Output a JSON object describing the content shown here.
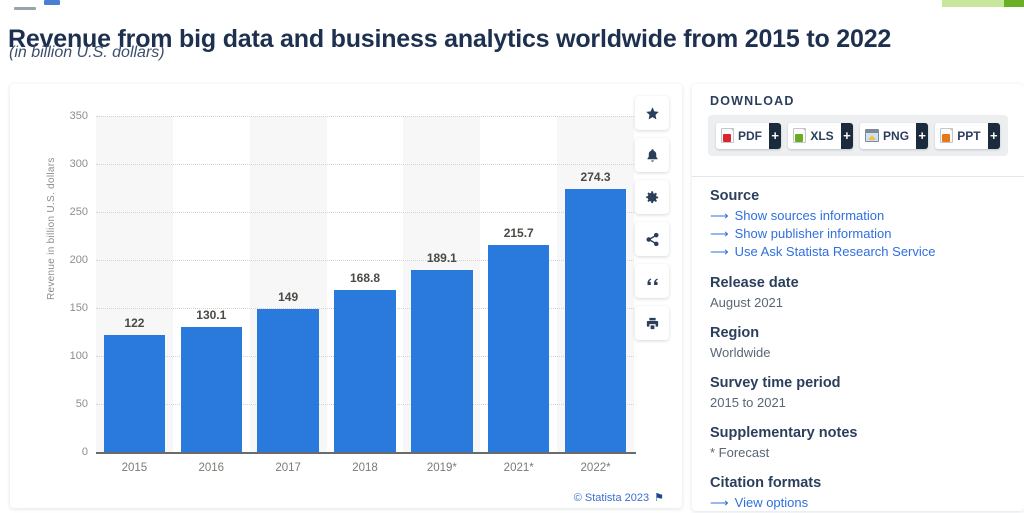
{
  "page": {
    "title": "Revenue from big data and business analytics worldwide from 2015 to 2022",
    "subtitle": "(in billion U.S. dollars)",
    "copyright": "© Statista 2023",
    "flag_icon": "flag-icon"
  },
  "chart_data": {
    "type": "bar",
    "title": "Revenue from big data and business analytics worldwide from 2015 to 2022",
    "subtitle": "(in billion U.S. dollars)",
    "categories": [
      "2015",
      "2016",
      "2017",
      "2018",
      "2019*",
      "2021*",
      "2022*"
    ],
    "values": [
      122,
      130.1,
      149,
      168.8,
      189.1,
      215.7,
      274.3
    ],
    "labels": [
      "122",
      "130.1",
      "149",
      "168.8",
      "189.1",
      "215.7",
      "274.3"
    ],
    "xlabel": "",
    "ylabel": "Revenue in billion U.S. dollars",
    "ylim": [
      0,
      350
    ],
    "yticks": [
      0,
      50,
      100,
      150,
      200,
      250,
      300,
      350
    ],
    "ytick_labels": [
      "0",
      "50",
      "100",
      "150",
      "200",
      "250",
      "300",
      "350"
    ],
    "bar_color": "#2a7ade",
    "grid": true,
    "legend": false
  },
  "rail": {
    "items": [
      {
        "name": "favorite-star-icon",
        "label": "Add to favorites"
      },
      {
        "name": "bell-icon",
        "label": "Notifications"
      },
      {
        "name": "gear-icon",
        "label": "Settings"
      },
      {
        "name": "share-icon",
        "label": "Share"
      },
      {
        "name": "quote-icon",
        "label": "Cite"
      },
      {
        "name": "print-icon",
        "label": "Print"
      }
    ]
  },
  "sidebar": {
    "download": {
      "heading": "DOWNLOAD",
      "buttons": [
        {
          "label": "PDF",
          "plus": "+",
          "color": "#d8262c",
          "icon": "pdf-file-icon"
        },
        {
          "label": "XLS",
          "plus": "+",
          "color": "#6aab1f",
          "icon": "xls-file-icon"
        },
        {
          "label": "PNG",
          "plus": "+",
          "color": "#3d7cc9",
          "icon": "png-image-icon"
        },
        {
          "label": "PPT",
          "plus": "+",
          "color": "#e8761a",
          "icon": "ppt-file-icon"
        }
      ]
    },
    "source": {
      "heading": "Source",
      "links": [
        "Show sources information",
        "Show publisher information",
        "Use Ask Statista Research Service"
      ]
    },
    "release_date": {
      "heading": "Release date",
      "value": "August 2021"
    },
    "region": {
      "heading": "Region",
      "value": "Worldwide"
    },
    "survey_period": {
      "heading": "Survey time period",
      "value": "2015 to 2021"
    },
    "supplementary": {
      "heading": "Supplementary notes",
      "value": "* Forecast"
    },
    "citation": {
      "heading": "Citation formats",
      "link": "View options"
    }
  }
}
